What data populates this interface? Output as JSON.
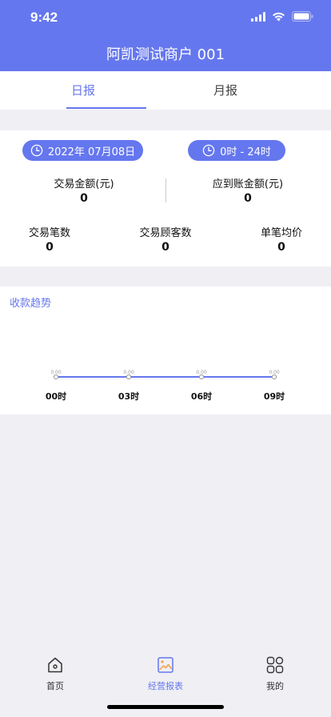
{
  "status_bar": {
    "time": "9:42"
  },
  "header": {
    "title": "阿凯测试商户 001"
  },
  "tabs": [
    {
      "label": "日报",
      "active": true
    },
    {
      "label": "月报",
      "active": false
    }
  ],
  "summary": {
    "date_filter": "2022年 07月08日",
    "time_filter": "0时 - 24时",
    "stats_top": [
      {
        "label": "交易金额(元)",
        "value": "0"
      },
      {
        "label": "应到账金额(元)",
        "value": "0"
      }
    ],
    "stats_bottom": [
      {
        "label": "交易笔数",
        "value": "0"
      },
      {
        "label": "交易顾客数",
        "value": "0"
      },
      {
        "label": "单笔均价",
        "value": "0"
      }
    ]
  },
  "trend": {
    "title": "收款趋势"
  },
  "chart_data": {
    "type": "line",
    "title": "收款趋势",
    "categories": [
      "00时",
      "03时",
      "06时",
      "09时"
    ],
    "series": [
      {
        "values": [
          0.0,
          0.0,
          0.0,
          0.0
        ]
      }
    ],
    "data_labels": [
      "0.00",
      "0.00",
      "0.00",
      "0.00"
    ],
    "grid": false,
    "color": "#6577ee"
  },
  "tabbar": {
    "items": [
      {
        "label": "首页",
        "icon": "home-icon",
        "active": false
      },
      {
        "label": "经营报表",
        "icon": "report-icon",
        "active": true
      },
      {
        "label": "我的",
        "icon": "grid-icon",
        "active": false
      }
    ]
  },
  "colors": {
    "accent": "#6577ee",
    "background": "#efeff4"
  }
}
